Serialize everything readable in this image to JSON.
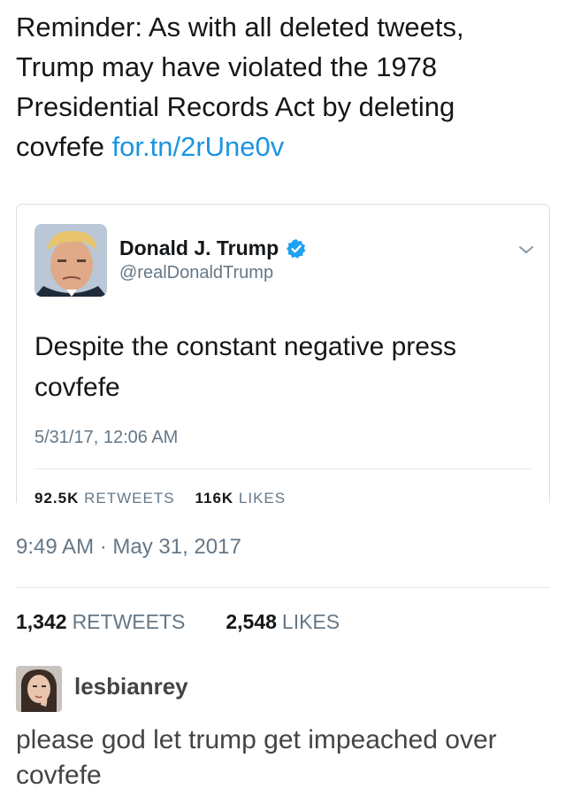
{
  "tweet": {
    "text_main": "Reminder: As with all deleted tweets, Trump may have violated the 1978 Presidential Records Act by deleting covfefe ",
    "link": "for.tn/2rUne0v",
    "timestamp": "9:49 AM · May 31, 2017",
    "retweets_count": "1,342",
    "retweets_label": "RETWEETS",
    "likes_count": "2,548",
    "likes_label": "LIKES"
  },
  "quoted_tweet": {
    "name": "Donald J. Trump",
    "handle": "@realDonaldTrump",
    "text": "Despite the constant negative press covfefe",
    "timestamp": "5/31/17, 12:06 AM",
    "retweets_count": "92.5K",
    "retweets_label": "RETWEETS",
    "likes_count": "116K",
    "likes_label": "LIKES",
    "verified_color": "#1da1f2"
  },
  "reblog": {
    "username": "lesbianrey",
    "text": "please god let trump get impeached over covfefe"
  },
  "colors": {
    "link": "#1b95e0",
    "secondary_text": "#657786",
    "primary_text": "#14171a"
  },
  "icons": {
    "verified": "verified-badge-icon",
    "chevron": "chevron-down-icon"
  }
}
